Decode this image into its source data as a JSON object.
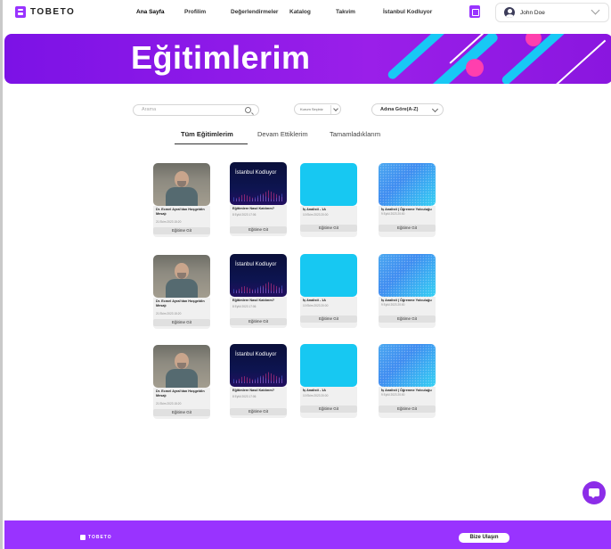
{
  "nav": {
    "logo_text": "TOBETO",
    "items": [
      {
        "label": "Ana Sayfa"
      },
      {
        "label": "Profilim"
      },
      {
        "label": "Değerlendirmeler"
      },
      {
        "label": "Katalog"
      },
      {
        "label": "Takvim"
      },
      {
        "label": "İstanbul Kodluyor"
      }
    ],
    "user_name": "John Doe"
  },
  "banner": {
    "title": "Eğitimlerim"
  },
  "filters": {
    "search_placeholder": "Arama",
    "filter_label": "Kurum Seçiniz",
    "sort_label": "Adına Göre(A-Z)"
  },
  "tabs": [
    {
      "label": "Tüm Eğitimlerim"
    },
    {
      "label": "Devam Ettiklerim"
    },
    {
      "label": "Tamamladıklarım"
    }
  ],
  "cards": [
    {
      "title": "Dr. Ecmel Ayral'dan Hoşgeldin Mesajı",
      "date": "21 Ekim 2023 15:20",
      "button": "Eğitime Git"
    },
    {
      "title": "Eğitimlere Nasıl Katılırım?",
      "date": "8 Eylül 2023 17:06",
      "button": "Eğitime Git"
    },
    {
      "title": "İş Analisti - 1A",
      "date": "10 Ekim 2023 20:00",
      "button": "Eğitime Git"
    },
    {
      "title": "İş Analisti | Öğrenme Yolculuğu",
      "date": "9 Eylül 2023 20:00",
      "button": "Eğitime Git"
    }
  ],
  "thumb_texts": {
    "ik": "İstanbul Kodluyor"
  },
  "footer": {
    "logo_text": "TOBETO",
    "contact_label": "Bize Ulaşın"
  },
  "colors": {
    "brand": "#9933ff",
    "banner": "#8a16df",
    "cyan": "#17c8f2"
  }
}
